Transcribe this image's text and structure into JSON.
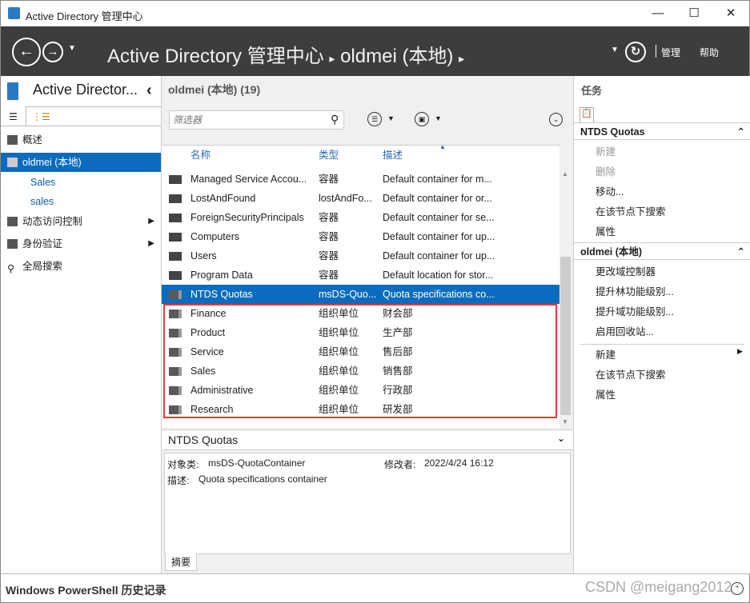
{
  "window": {
    "title": "Active Directory 管理中心",
    "minimize": "—",
    "maximize": "☐",
    "close": "✕"
  },
  "header": {
    "breadcrumb_root": "Active Directory 管理中心",
    "breadcrumb_sep": "▸",
    "breadcrumb_node": "oldmei (本地)",
    "manage": "管理",
    "help": "帮助"
  },
  "left": {
    "title": "Active Director...",
    "collapse": "‹",
    "items": [
      {
        "label": "概述"
      },
      {
        "label": "oldmei (本地)"
      },
      {
        "label": "Sales"
      },
      {
        "label": "sales"
      },
      {
        "label": "动态访问控制"
      },
      {
        "label": "身份验证"
      },
      {
        "label": "全局搜索"
      }
    ]
  },
  "center": {
    "title": "oldmei (本地)  (19)",
    "filter_placeholder": "筛选器",
    "columns": [
      "名称",
      "类型",
      "描述"
    ],
    "rows": [
      {
        "name": "Managed Service Accou...",
        "type": "容器",
        "desc": "Default container for m..."
      },
      {
        "name": "LostAndFound",
        "type": "lostAndFo...",
        "desc": "Default container for or..."
      },
      {
        "name": "ForeignSecurityPrincipals",
        "type": "容器",
        "desc": "Default container for se..."
      },
      {
        "name": "Computers",
        "type": "容器",
        "desc": "Default container for up..."
      },
      {
        "name": "Users",
        "type": "容器",
        "desc": "Default container for up..."
      },
      {
        "name": "Program Data",
        "type": "容器",
        "desc": "Default location for stor..."
      },
      {
        "name": "NTDS Quotas",
        "type": "msDS-Quo...",
        "desc": "Quota specifications co..."
      },
      {
        "name": "Finance",
        "type": "组织单位",
        "desc": "财会部"
      },
      {
        "name": "Product",
        "type": "组织单位",
        "desc": "生产部"
      },
      {
        "name": "Service",
        "type": "组织单位",
        "desc": "售后部"
      },
      {
        "name": "Sales",
        "type": "组织单位",
        "desc": "销售部"
      },
      {
        "name": "Administrative",
        "type": "组织单位",
        "desc": "行政部"
      },
      {
        "name": "Research",
        "type": "组织单位",
        "desc": "研发部"
      }
    ],
    "detail": {
      "title": "NTDS Quotas",
      "class_label": "对象类:",
      "class_value": "msDS-QuotaContainer",
      "modified_label": "修改者:",
      "modified_value": "2022/4/24 16:12",
      "desc_label": "描述:",
      "desc_value": "Quota specifications container",
      "tab": "摘要"
    }
  },
  "tasks": {
    "title": "任务",
    "section1": "NTDS Quotas",
    "s1_items": [
      "新建",
      "删除",
      "移动...",
      "在该节点下搜索",
      "属性"
    ],
    "section2": "oldmei (本地)",
    "s2_items": [
      "更改域控制器",
      "提升林功能级别...",
      "提升域功能级别...",
      "启用回收站...",
      "新建",
      "在该节点下搜索",
      "属性"
    ]
  },
  "status": {
    "label": "Windows PowerShell 历史记录",
    "watermark": "CSDN @meigang2012"
  }
}
